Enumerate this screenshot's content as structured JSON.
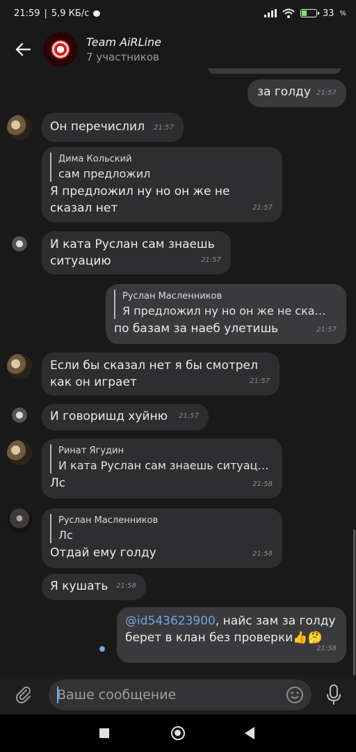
{
  "status_bar": {
    "time": "21:59",
    "speed": "5,9 КБ/с",
    "battery": "33",
    "battery_unit": "%",
    "battery_level": 0.33
  },
  "header": {
    "title": "Team AiRLine",
    "subtitle": "7 участников"
  },
  "messages": [
    {
      "text": "за голду",
      "time": "21:57"
    },
    {
      "text": "Он перечислил",
      "time": "21:57"
    },
    {
      "reply_name": "Дима Кольский",
      "reply_text": "сам предложил",
      "text_1": "Я предложил ну но он же не",
      "text_2": "сказал нет",
      "time": "21:57"
    },
    {
      "text_1": "И ката Руслан сам знаешь",
      "text_2": "ситуацию",
      "time": "21:57"
    },
    {
      "reply_name": "Руслан Масленников",
      "reply_text": "Я предложил ну но он же не ска…",
      "text": "по базам за наеб улетишь",
      "time": "21:57"
    },
    {
      "text_1": "Если бы сказал нет я бы смотрел",
      "text_2": "как он играет",
      "time": "21:57"
    },
    {
      "text": "И говоришд хуйню",
      "time": "21:57"
    },
    {
      "reply_name": "Ринат Ягудин",
      "reply_text": "И ката Руслан сам знаешь ситуац…",
      "text": "Лс",
      "time": "21:58"
    },
    {
      "reply_name": "Руслан Масленников",
      "reply_text": "Лс",
      "text": "Отдай ему голду",
      "time": "21:58"
    },
    {
      "text": "Я кушать",
      "time": "21:58"
    },
    {
      "mention": "@id543623900",
      "text_1": ", найс зам за голду",
      "text_2": "берет в клан без проверки👍🤔",
      "time": "21:58"
    }
  ],
  "composer": {
    "placeholder": "Ваше сообщение"
  },
  "colors": {
    "background": "#19191a",
    "bubble": "#2e2e30",
    "mention": "#6fa8e8"
  }
}
